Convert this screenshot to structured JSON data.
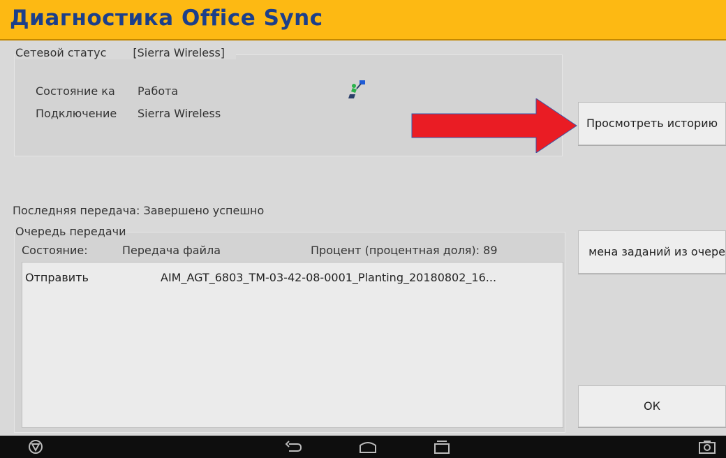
{
  "window": {
    "title": "Диагностика Office Sync"
  },
  "network_status": {
    "legend": "Сетевой статус",
    "legend_value": "[Sierra Wireless]",
    "rows": [
      {
        "label": "Состояние ка",
        "value": "Работа"
      },
      {
        "label": "Подключение",
        "value": "Sierra Wireless"
      }
    ],
    "icon": "network-connection-icon"
  },
  "buttons": {
    "view_history": "Просмотреть историю",
    "cancel_jobs": "мена заданий из очере",
    "ok": "ОК"
  },
  "last_transfer": {
    "label": "Последняя передача:",
    "value": "Завершено успешно"
  },
  "queue": {
    "legend": "Очередь передачи",
    "state_label": "Состояние:",
    "state_value": "Передача файла",
    "percent_label": "Процент (процентная доля): 89",
    "percent": 89,
    "items": [
      {
        "action": "Отправить",
        "file": "AIM_AGT_6803_TM-03-42-08-0001_Planting_20180802_16..."
      }
    ]
  },
  "navbar": {
    "icons": [
      "brand-logo-icon",
      "back-icon",
      "home-icon",
      "recent-apps-icon",
      "screenshot-icon"
    ]
  },
  "colors": {
    "title_bar": "#fdb913",
    "title_text": "#1c3f8a",
    "arrow": "#ea1c24",
    "underline": "#e0261f"
  }
}
